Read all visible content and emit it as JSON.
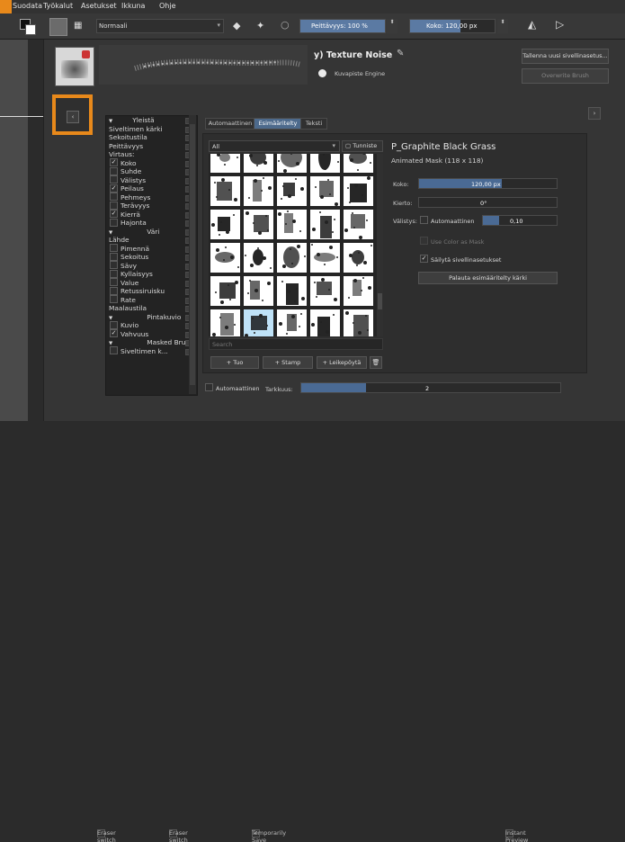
{
  "menu": {
    "items": [
      "se",
      "Suodata",
      "Työkalut",
      "Asetukset",
      "Ikkuna",
      "Ohje"
    ]
  },
  "toolbar": {
    "preset_name": "Normaali",
    "opacity_label": "Peittävyys: 100 %",
    "size_label": "Koko: 120,00 px",
    "opacity_fraction": 1.0,
    "size_fraction": 0.6
  },
  "editor": {
    "title": "y) Texture Noise",
    "engine": "Kuvapiste Engine",
    "save_new": "Tallenna uusi sivellinasetus...",
    "overwrite": "Overwrite Brush"
  },
  "sidebar": {
    "items": [
      {
        "label": "Yleistä",
        "kind": "header"
      },
      {
        "label": "Siveltimen kärki",
        "kind": "plain"
      },
      {
        "label": "Sekoitustila",
        "kind": "plain"
      },
      {
        "label": "Peittävyys",
        "kind": "plain"
      },
      {
        "label": "Virtaus:",
        "kind": "plain"
      },
      {
        "label": "Koko",
        "kind": "check",
        "checked": true
      },
      {
        "label": "Suhde",
        "kind": "check",
        "checked": false
      },
      {
        "label": "Välistys",
        "kind": "check",
        "checked": false
      },
      {
        "label": "Peilaus",
        "kind": "check",
        "checked": true
      },
      {
        "label": "Pehmeys",
        "kind": "check",
        "checked": false
      },
      {
        "label": "Terävyys",
        "kind": "check",
        "checked": false
      },
      {
        "label": "Kierrä",
        "kind": "check",
        "checked": true
      },
      {
        "label": "Hajonta",
        "kind": "check",
        "checked": false
      },
      {
        "label": "Väri",
        "kind": "header"
      },
      {
        "label": "Lähde",
        "kind": "plain"
      },
      {
        "label": "Pimennä",
        "kind": "check",
        "checked": false
      },
      {
        "label": "Sekoitus",
        "kind": "check",
        "checked": false
      },
      {
        "label": "Sävy",
        "kind": "check",
        "checked": false
      },
      {
        "label": "Kyllaisyys",
        "kind": "check",
        "checked": false
      },
      {
        "label": "Value",
        "kind": "check",
        "checked": false
      },
      {
        "label": "Retussiruisku",
        "kind": "check",
        "checked": false
      },
      {
        "label": "Rate",
        "kind": "check",
        "checked": false
      },
      {
        "label": "Maalaustila",
        "kind": "plain"
      },
      {
        "label": "Pintakuvio",
        "kind": "header"
      },
      {
        "label": "Kuvio",
        "kind": "check",
        "checked": false
      },
      {
        "label": "Vahvuus",
        "kind": "check",
        "checked": true
      },
      {
        "label": "Masked Brush",
        "kind": "header"
      },
      {
        "label": "Siveltimen k...",
        "kind": "check",
        "checked": false
      }
    ]
  },
  "tabs": [
    "Automaattinen",
    "Esimääritelty",
    "Teksti"
  ],
  "tab_active": 1,
  "filter": {
    "value": "All",
    "tags_label": "Tunniste"
  },
  "search_placeholder": "Search",
  "actions": {
    "import": "+ Tuo",
    "stamp": "+ Stamp",
    "clipboard": "+ Leikepöytä"
  },
  "brush_info": {
    "name": "P_Graphite Black Grass",
    "type": "Animated Mask (118 x 118)",
    "size_label": "Koko:",
    "size_value": "120,00 px",
    "size_fraction": 0.6,
    "rotation_label": "Kierto:",
    "rotation_value": "0°",
    "spacing_label": "Välistys:",
    "spacing_auto": "Automaattinen",
    "spacing_value": "0,10",
    "spacing_fraction": 0.22,
    "use_color_mask": "Use Color as Mask",
    "keep_brush": "Säilytä sivellinasetukset",
    "reset_button": "Palauta esimääritelty kärki"
  },
  "bottom_bar": {
    "auto_label": "Automaattinen",
    "precision_label": "Tarkkuus:",
    "precision_value": "2",
    "precision_fraction": 0.25
  },
  "footer": {
    "eraser_size": "Eraser switch size",
    "eraser_opacity": "Eraser switch opacity",
    "temp_save": "Temporarily Save Tweaks To Presets",
    "instant_preview": "Instant Preview"
  },
  "colors": {
    "accent": "#4a6a94",
    "orange": "#e8891b",
    "highlight": "#5d7ea6"
  }
}
